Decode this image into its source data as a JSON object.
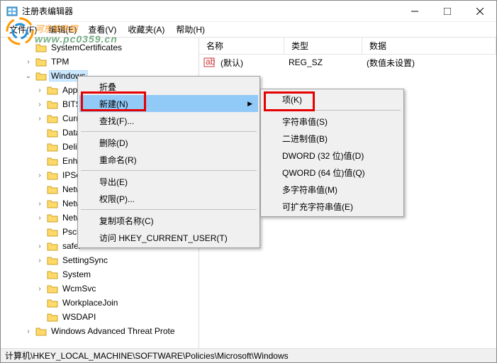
{
  "window": {
    "title": "注册表编辑器"
  },
  "menubar": [
    "文件(F)",
    "编辑(E)",
    "查看(V)",
    "收藏夹(A)",
    "帮助(H)"
  ],
  "list": {
    "headers": {
      "name": "名称",
      "type": "类型",
      "data": "数据"
    },
    "rows": [
      {
        "name": "(默认)",
        "type": "REG_SZ",
        "data": "(数值未设置)"
      }
    ]
  },
  "tree": {
    "items": [
      {
        "indent": 2,
        "expander": "",
        "label": "SystemCertificates"
      },
      {
        "indent": 2,
        "expander": ">",
        "label": "TPM"
      },
      {
        "indent": 2,
        "expander": "v",
        "label": "Windows",
        "selected": true
      },
      {
        "indent": 3,
        "expander": ">",
        "label": "Appx"
      },
      {
        "indent": 3,
        "expander": ">",
        "label": "BITS"
      },
      {
        "indent": 3,
        "expander": ">",
        "label": "Curre"
      },
      {
        "indent": 3,
        "expander": "",
        "label": "DataC"
      },
      {
        "indent": 3,
        "expander": "",
        "label": "Delive"
      },
      {
        "indent": 3,
        "expander": "",
        "label": "Enhan"
      },
      {
        "indent": 3,
        "expander": ">",
        "label": "IPSec"
      },
      {
        "indent": 3,
        "expander": "",
        "label": "Netwo"
      },
      {
        "indent": 3,
        "expander": ">",
        "label": "Netwo"
      },
      {
        "indent": 3,
        "expander": ">",
        "label": "NetworkProvider"
      },
      {
        "indent": 3,
        "expander": "",
        "label": "Psched"
      },
      {
        "indent": 3,
        "expander": ">",
        "label": "safer"
      },
      {
        "indent": 3,
        "expander": ">",
        "label": "SettingSync"
      },
      {
        "indent": 3,
        "expander": "",
        "label": "System"
      },
      {
        "indent": 3,
        "expander": ">",
        "label": "WcmSvc"
      },
      {
        "indent": 3,
        "expander": "",
        "label": "WorkplaceJoin"
      },
      {
        "indent": 3,
        "expander": "",
        "label": "WSDAPI"
      },
      {
        "indent": 2,
        "expander": ">",
        "label": "Windows Advanced Threat Prote"
      }
    ]
  },
  "context_main": [
    {
      "label": "折叠",
      "type": "item"
    },
    {
      "label": "新建(N)",
      "type": "item",
      "submenu": true,
      "highlighted": true
    },
    {
      "label": "查找(F)...",
      "type": "item"
    },
    {
      "type": "sep"
    },
    {
      "label": "删除(D)",
      "type": "item"
    },
    {
      "label": "重命名(R)",
      "type": "item"
    },
    {
      "type": "sep"
    },
    {
      "label": "导出(E)",
      "type": "item"
    },
    {
      "label": "权限(P)...",
      "type": "item"
    },
    {
      "type": "sep"
    },
    {
      "label": "复制项名称(C)",
      "type": "item"
    },
    {
      "label": "访问 HKEY_CURRENT_USER(T)",
      "type": "item"
    }
  ],
  "context_sub": [
    {
      "label": "项(K)",
      "type": "item"
    },
    {
      "type": "sep"
    },
    {
      "label": "字符串值(S)",
      "type": "item"
    },
    {
      "label": "二进制值(B)",
      "type": "item"
    },
    {
      "label": "DWORD (32 位)值(D)",
      "type": "item"
    },
    {
      "label": "QWORD (64 位)值(Q)",
      "type": "item"
    },
    {
      "label": "多字符串值(M)",
      "type": "item"
    },
    {
      "label": "可扩充字符串值(E)",
      "type": "item"
    }
  ],
  "statusbar": "计算机\\HKEY_LOCAL_MACHINE\\SOFTWARE\\Policies\\Microsoft\\Windows",
  "watermark": {
    "line1": "河东软件园",
    "line2": "www.pc0359.cn"
  }
}
